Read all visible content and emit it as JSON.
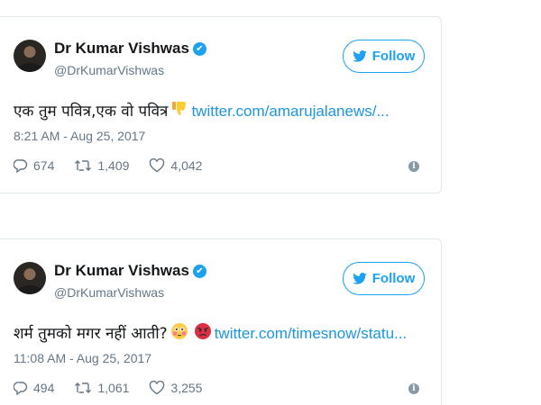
{
  "tweets": [
    {
      "author": {
        "name": "Dr Kumar Vishwas",
        "handle": "@DrKumarVishwas"
      },
      "follow_label": "Follow",
      "text": "एक तुम पवित्र,एक वो पवित्र",
      "emoji_icons": [
        "thumbs-down-icon"
      ],
      "link": "twitter.com/amarujalanews/...",
      "timestamp": "8:21 AM - Aug 25, 2017",
      "replies": "674",
      "retweets": "1,409",
      "likes": "4,042"
    },
    {
      "author": {
        "name": "Dr Kumar Vishwas",
        "handle": "@DrKumarVishwas"
      },
      "follow_label": "Follow",
      "text": "शर्म तुमको मगर नहीं आती?",
      "emoji_icons": [
        "flushed-face-icon",
        "angry-face-icon"
      ],
      "link": "twitter.com/timesnow/statu...",
      "timestamp": "11:08 AM - Aug 25, 2017",
      "replies": "494",
      "retweets": "1,061",
      "likes": "3,255"
    }
  ],
  "colors": {
    "accent": "#1da1f2",
    "link": "#1b95e0",
    "muted": "#657786",
    "border": "#e1e8ed"
  }
}
